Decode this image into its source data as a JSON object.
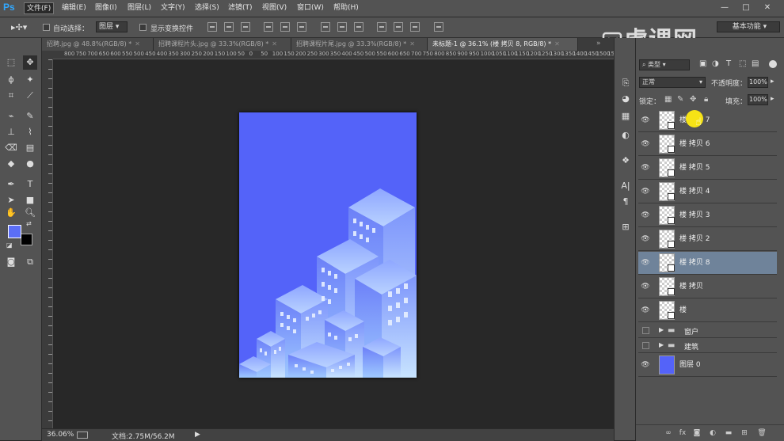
{
  "app": {
    "logo": "Ps"
  },
  "menu": [
    "文件(F)",
    "编辑(E)",
    "图像(I)",
    "图层(L)",
    "文字(Y)",
    "选择(S)",
    "滤镜(T)",
    "视图(V)",
    "窗口(W)",
    "帮助(H)"
  ],
  "window_controls": [
    "—",
    "□",
    "✕"
  ],
  "options": {
    "auto_select_label": "自动选择：",
    "auto_select_value": "图层",
    "show_transform_label": "显示变换控件",
    "workspace": "基本功能"
  },
  "tabs": [
    {
      "label": "招聘.jpg @ 48.8%(RGB/8) *",
      "active": false
    },
    {
      "label": "招聘课程片头.jpg @ 33.3%(RGB/8) *",
      "active": false
    },
    {
      "label": "招聘课程片尾.jpg @ 33.3%(RGB/8) *",
      "active": false
    },
    {
      "label": "未标题-1 @ 36.1% (楼 拷贝 8, RGB/8) *",
      "active": true
    }
  ],
  "ruler": {
    "top": [
      "800",
      "750",
      "700",
      "650",
      "600",
      "550",
      "500",
      "450",
      "400",
      "350",
      "300",
      "250",
      "200",
      "150",
      "100",
      "50",
      "0",
      "50",
      "100",
      "150",
      "200",
      "250",
      "300",
      "350",
      "400",
      "450",
      "500",
      "550",
      "600",
      "650",
      "700",
      "750",
      "800",
      "850",
      "900",
      "950",
      "1000",
      "1050",
      "1100",
      "1150",
      "1200",
      "1250",
      "1300",
      "1350",
      "1400",
      "1450",
      "1500",
      "155"
    ]
  },
  "status": {
    "zoom": "36.06%",
    "doc": "文档:2.75M/56.2M"
  },
  "layers_panel": {
    "filter_type": "类型",
    "blend_mode": "正常",
    "opacity_label": "不透明度：",
    "opacity_value": "100%",
    "lock_label": "锁定：",
    "fill_label": "填充：",
    "fill_value": "100%",
    "layers": [
      {
        "name": "楼 拷贝 7",
        "kind": "smart",
        "selected": false
      },
      {
        "name": "楼 拷贝 6",
        "kind": "smart",
        "selected": false
      },
      {
        "name": "楼 拷贝 5",
        "kind": "smart",
        "selected": false
      },
      {
        "name": "楼 拷贝 4",
        "kind": "smart",
        "selected": false
      },
      {
        "name": "楼 拷贝 3",
        "kind": "smart",
        "selected": false
      },
      {
        "name": "楼 拷贝 2",
        "kind": "smart",
        "selected": false
      },
      {
        "name": "楼 拷贝 8",
        "kind": "smart",
        "selected": true
      },
      {
        "name": "楼 拷贝",
        "kind": "smart",
        "selected": false
      },
      {
        "name": "楼",
        "kind": "smart",
        "selected": false
      }
    ],
    "groups": [
      {
        "name": "窗户"
      },
      {
        "name": "建筑"
      }
    ],
    "background_layer": {
      "name": "图层 0"
    }
  },
  "colors": {
    "foreground": "#5b6ef5",
    "background": "#000000",
    "canvas_bg": "#5463f9"
  },
  "watermark": "虎课网"
}
